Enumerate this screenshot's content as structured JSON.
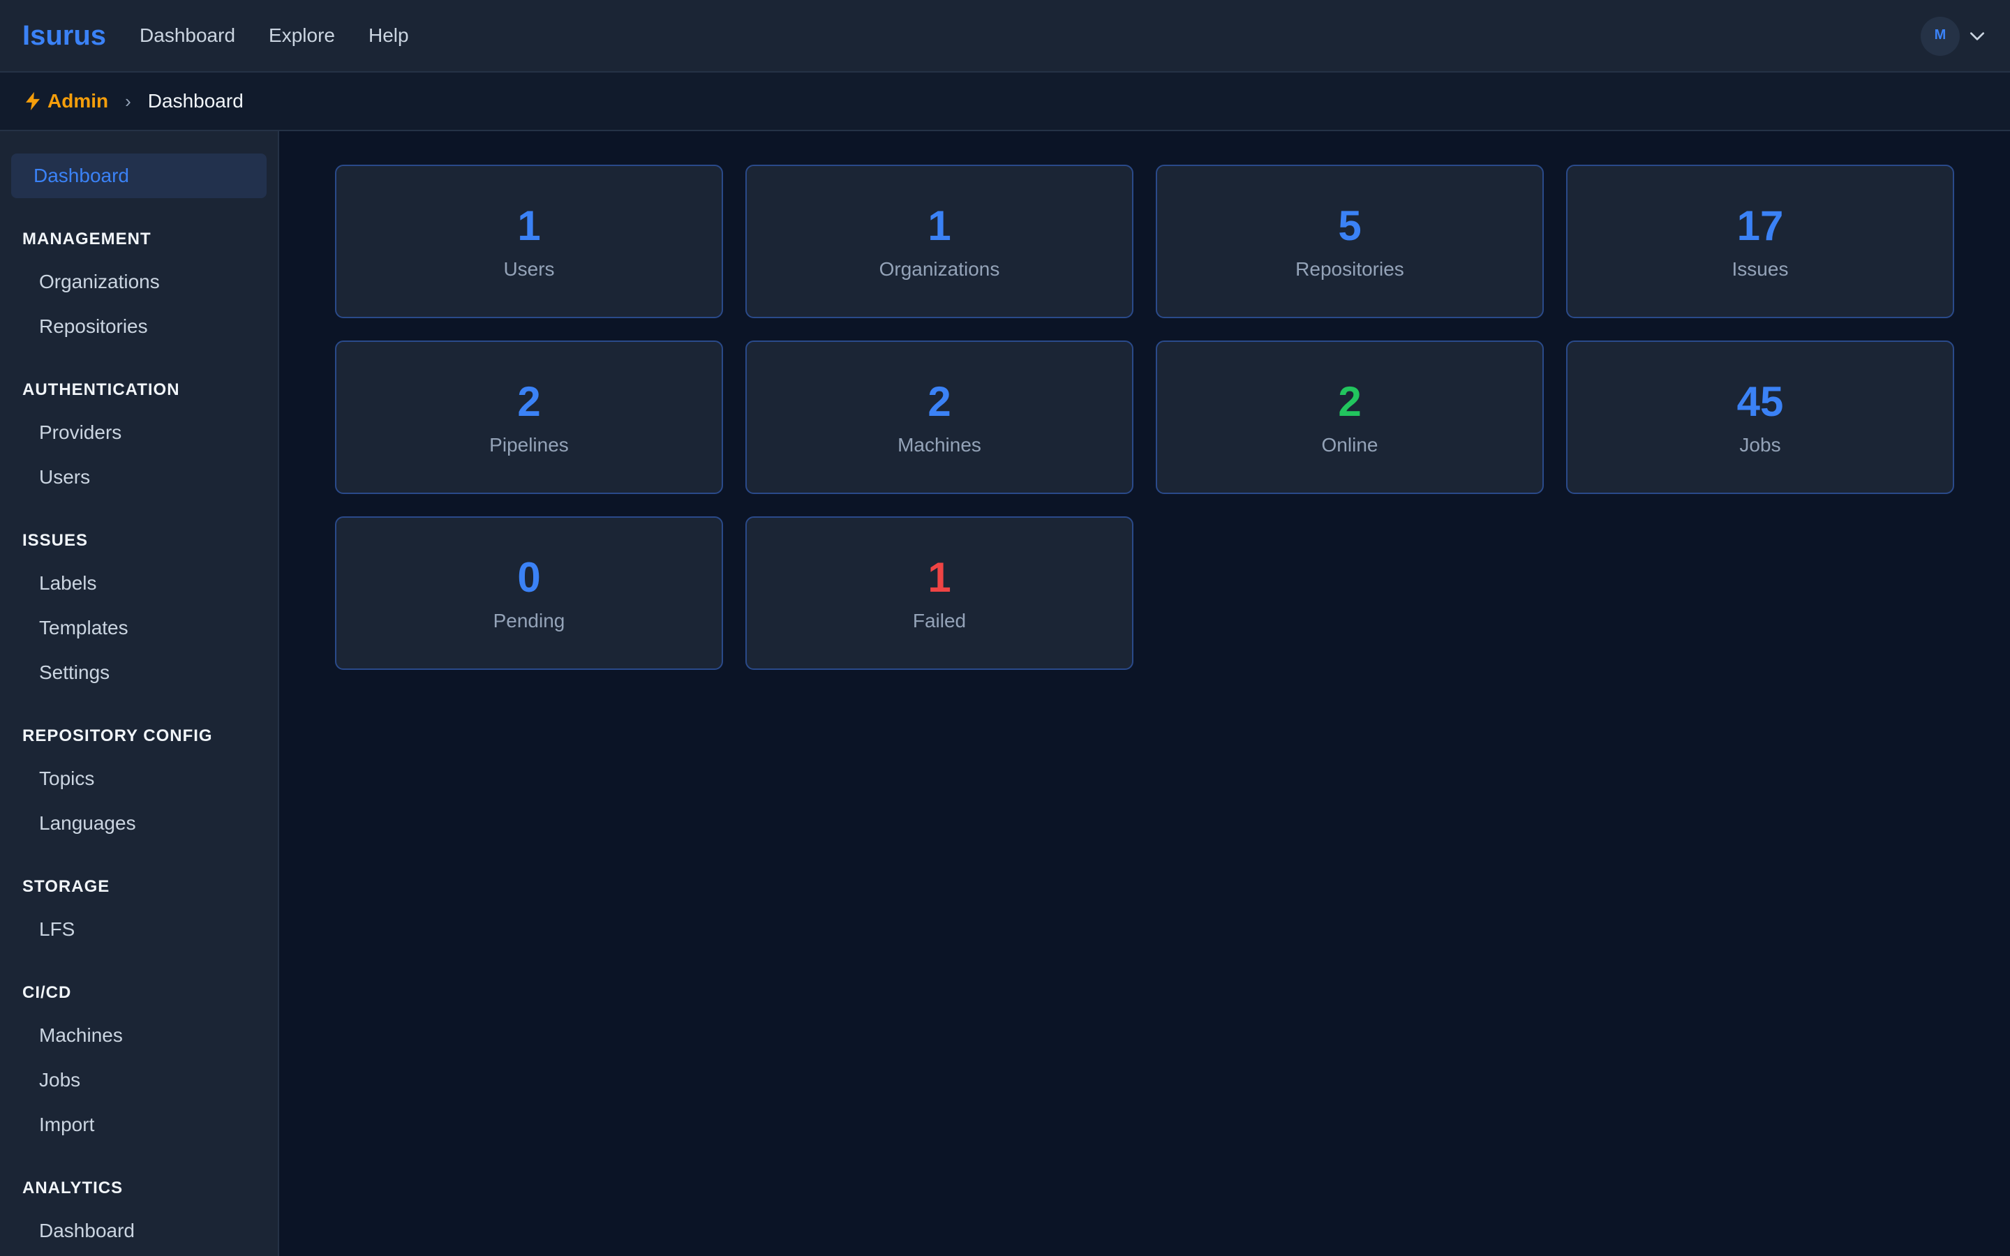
{
  "app": {
    "brand": "Isurus"
  },
  "topnav": {
    "items": [
      "Dashboard",
      "Explore",
      "Help"
    ]
  },
  "user": {
    "initial": "M"
  },
  "breadcrumb": {
    "root": "Admin",
    "separator": "›",
    "current": "Dashboard"
  },
  "sidebar": {
    "active": "Dashboard",
    "sections": [
      {
        "title": "MANAGEMENT",
        "items": [
          "Organizations",
          "Repositories"
        ]
      },
      {
        "title": "AUTHENTICATION",
        "items": [
          "Providers",
          "Users"
        ]
      },
      {
        "title": "ISSUES",
        "items": [
          "Labels",
          "Templates",
          "Settings"
        ]
      },
      {
        "title": "REPOSITORY CONFIG",
        "items": [
          "Topics",
          "Languages"
        ]
      },
      {
        "title": "STORAGE",
        "items": [
          "LFS"
        ]
      },
      {
        "title": "CI/CD",
        "items": [
          "Machines",
          "Jobs",
          "Import"
        ]
      },
      {
        "title": "ANALYTICS",
        "items": [
          "Dashboard"
        ]
      }
    ]
  },
  "stats": [
    {
      "value": "1",
      "label": "Users"
    },
    {
      "value": "1",
      "label": "Organizations"
    },
    {
      "value": "5",
      "label": "Repositories"
    },
    {
      "value": "17",
      "label": "Issues"
    },
    {
      "value": "2",
      "label": "Pipelines"
    },
    {
      "value": "2",
      "label": "Machines"
    },
    {
      "value": "2",
      "label": "Online"
    },
    {
      "value": "45",
      "label": "Jobs"
    },
    {
      "value": "0",
      "label": "Pending"
    },
    {
      "value": "1",
      "label": "Failed"
    }
  ],
  "colors": {
    "accent": "#3b82f6",
    "online": "#22c55e",
    "failed": "#ef4444",
    "admin": "#f59e0b"
  }
}
